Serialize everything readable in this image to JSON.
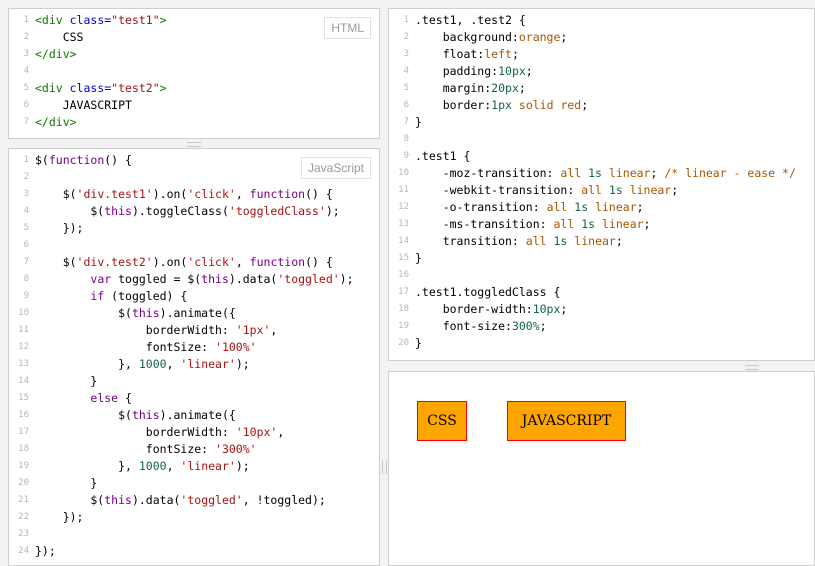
{
  "html_panel": {
    "badge": "HTML",
    "lines": [
      {
        "n": "1",
        "seg": [
          {
            "t": "<div ",
            "c": "t"
          },
          {
            "t": "class=",
            "c": "a"
          },
          {
            "t": "\"test1\"",
            "c": "s"
          },
          {
            "t": ">",
            "c": "t"
          }
        ]
      },
      {
        "n": "2",
        "seg": [
          {
            "t": "    CSS",
            "c": "p"
          }
        ]
      },
      {
        "n": "3",
        "seg": [
          {
            "t": "</div>",
            "c": "t"
          }
        ]
      },
      {
        "n": "4",
        "seg": []
      },
      {
        "n": "5",
        "seg": [
          {
            "t": "<div ",
            "c": "t"
          },
          {
            "t": "class=",
            "c": "a"
          },
          {
            "t": "\"test2\"",
            "c": "s"
          },
          {
            "t": ">",
            "c": "t"
          }
        ]
      },
      {
        "n": "6",
        "seg": [
          {
            "t": "    JAVASCRIPT",
            "c": "p"
          }
        ]
      },
      {
        "n": "7",
        "seg": [
          {
            "t": "</div>",
            "c": "t"
          }
        ]
      }
    ]
  },
  "js_panel": {
    "badge": "JavaScript",
    "lines": [
      {
        "n": "1",
        "seg": [
          {
            "t": "$(",
            "c": "p"
          },
          {
            "t": "function",
            "c": "k"
          },
          {
            "t": "() {",
            "c": "p"
          }
        ]
      },
      {
        "n": "2",
        "seg": []
      },
      {
        "n": "3",
        "seg": [
          {
            "t": "    $(",
            "c": "p"
          },
          {
            "t": "'div.test1'",
            "c": "s"
          },
          {
            "t": ").on(",
            "c": "p"
          },
          {
            "t": "'click'",
            "c": "s"
          },
          {
            "t": ", ",
            "c": "p"
          },
          {
            "t": "function",
            "c": "k"
          },
          {
            "t": "() {",
            "c": "p"
          }
        ]
      },
      {
        "n": "4",
        "seg": [
          {
            "t": "        $(",
            "c": "p"
          },
          {
            "t": "this",
            "c": "k"
          },
          {
            "t": ").toggleClass(",
            "c": "p"
          },
          {
            "t": "'toggledClass'",
            "c": "s"
          },
          {
            "t": ");",
            "c": "p"
          }
        ]
      },
      {
        "n": "5",
        "seg": [
          {
            "t": "    });",
            "c": "p"
          }
        ]
      },
      {
        "n": "6",
        "seg": []
      },
      {
        "n": "7",
        "seg": [
          {
            "t": "    $(",
            "c": "p"
          },
          {
            "t": "'div.test2'",
            "c": "s"
          },
          {
            "t": ").on(",
            "c": "p"
          },
          {
            "t": "'click'",
            "c": "s"
          },
          {
            "t": ", ",
            "c": "p"
          },
          {
            "t": "function",
            "c": "k"
          },
          {
            "t": "() {",
            "c": "p"
          }
        ]
      },
      {
        "n": "8",
        "seg": [
          {
            "t": "        ",
            "c": "p"
          },
          {
            "t": "var",
            "c": "k"
          },
          {
            "t": " toggled = $(",
            "c": "p"
          },
          {
            "t": "this",
            "c": "k"
          },
          {
            "t": ").data(",
            "c": "p"
          },
          {
            "t": "'toggled'",
            "c": "s"
          },
          {
            "t": ");",
            "c": "p"
          }
        ]
      },
      {
        "n": "9",
        "seg": [
          {
            "t": "        ",
            "c": "p"
          },
          {
            "t": "if",
            "c": "k"
          },
          {
            "t": " (toggled) {",
            "c": "p"
          }
        ]
      },
      {
        "n": "10",
        "seg": [
          {
            "t": "            $(",
            "c": "p"
          },
          {
            "t": "this",
            "c": "k"
          },
          {
            "t": ").animate({",
            "c": "p"
          }
        ]
      },
      {
        "n": "11",
        "seg": [
          {
            "t": "                borderWidth: ",
            "c": "p"
          },
          {
            "t": "'1px'",
            "c": "s"
          },
          {
            "t": ",",
            "c": "p"
          }
        ]
      },
      {
        "n": "12",
        "seg": [
          {
            "t": "                fontSize: ",
            "c": "p"
          },
          {
            "t": "'100%'",
            "c": "s"
          }
        ]
      },
      {
        "n": "13",
        "seg": [
          {
            "t": "            }, ",
            "c": "p"
          },
          {
            "t": "1000",
            "c": "n"
          },
          {
            "t": ", ",
            "c": "p"
          },
          {
            "t": "'linear'",
            "c": "s"
          },
          {
            "t": ");",
            "c": "p"
          }
        ]
      },
      {
        "n": "14",
        "seg": [
          {
            "t": "        }",
            "c": "p"
          }
        ]
      },
      {
        "n": "15",
        "seg": [
          {
            "t": "        ",
            "c": "p"
          },
          {
            "t": "else",
            "c": "k"
          },
          {
            "t": " {",
            "c": "p"
          }
        ]
      },
      {
        "n": "16",
        "seg": [
          {
            "t": "            $(",
            "c": "p"
          },
          {
            "t": "this",
            "c": "k"
          },
          {
            "t": ").animate({",
            "c": "p"
          }
        ]
      },
      {
        "n": "17",
        "seg": [
          {
            "t": "                borderWidth: ",
            "c": "p"
          },
          {
            "t": "'10px'",
            "c": "s"
          },
          {
            "t": ",",
            "c": "p"
          }
        ]
      },
      {
        "n": "18",
        "seg": [
          {
            "t": "                fontSize: ",
            "c": "p"
          },
          {
            "t": "'300%'",
            "c": "s"
          }
        ]
      },
      {
        "n": "19",
        "seg": [
          {
            "t": "            }, ",
            "c": "p"
          },
          {
            "t": "1000",
            "c": "n"
          },
          {
            "t": ", ",
            "c": "p"
          },
          {
            "t": "'linear'",
            "c": "s"
          },
          {
            "t": ");",
            "c": "p"
          }
        ]
      },
      {
        "n": "20",
        "seg": [
          {
            "t": "        }",
            "c": "p"
          }
        ]
      },
      {
        "n": "21",
        "seg": [
          {
            "t": "        $(",
            "c": "p"
          },
          {
            "t": "this",
            "c": "k"
          },
          {
            "t": ").data(",
            "c": "p"
          },
          {
            "t": "'toggled'",
            "c": "s"
          },
          {
            "t": ", !toggled);",
            "c": "p"
          }
        ]
      },
      {
        "n": "22",
        "seg": [
          {
            "t": "    });",
            "c": "p"
          }
        ]
      },
      {
        "n": "23",
        "seg": []
      },
      {
        "n": "24",
        "seg": [
          {
            "t": "});",
            "c": "p"
          }
        ]
      }
    ]
  },
  "css_panel": {
    "lines": [
      {
        "n": "1",
        "seg": [
          {
            "t": ".test1, .test2 {",
            "c": "p"
          }
        ]
      },
      {
        "n": "2",
        "seg": [
          {
            "t": "    background:",
            "c": "p"
          },
          {
            "t": "orange",
            "c": "v"
          },
          {
            "t": ";",
            "c": "p"
          }
        ]
      },
      {
        "n": "3",
        "seg": [
          {
            "t": "    float:",
            "c": "p"
          },
          {
            "t": "left",
            "c": "v"
          },
          {
            "t": ";",
            "c": "p"
          }
        ]
      },
      {
        "n": "4",
        "seg": [
          {
            "t": "    padding:",
            "c": "p"
          },
          {
            "t": "10px",
            "c": "n"
          },
          {
            "t": ";",
            "c": "p"
          }
        ]
      },
      {
        "n": "5",
        "seg": [
          {
            "t": "    margin:",
            "c": "p"
          },
          {
            "t": "20px",
            "c": "n"
          },
          {
            "t": ";",
            "c": "p"
          }
        ]
      },
      {
        "n": "6",
        "seg": [
          {
            "t": "    border:",
            "c": "p"
          },
          {
            "t": "1px",
            "c": "n"
          },
          {
            "t": " ",
            "c": "p"
          },
          {
            "t": "solid",
            "c": "v"
          },
          {
            "t": " ",
            "c": "p"
          },
          {
            "t": "red",
            "c": "v"
          },
          {
            "t": ";",
            "c": "p"
          }
        ]
      },
      {
        "n": "7",
        "seg": [
          {
            "t": "}",
            "c": "p"
          }
        ]
      },
      {
        "n": "8",
        "seg": []
      },
      {
        "n": "9",
        "seg": [
          {
            "t": ".test1 {",
            "c": "p"
          }
        ]
      },
      {
        "n": "10",
        "seg": [
          {
            "t": "    -moz-transition: ",
            "c": "p"
          },
          {
            "t": "all",
            "c": "v"
          },
          {
            "t": " ",
            "c": "p"
          },
          {
            "t": "1s",
            "c": "n"
          },
          {
            "t": " ",
            "c": "p"
          },
          {
            "t": "linear",
            "c": "v"
          },
          {
            "t": "; ",
            "c": "p"
          },
          {
            "t": "/* linear - ease */",
            "c": "c"
          }
        ]
      },
      {
        "n": "11",
        "seg": [
          {
            "t": "    -webkit-transition: ",
            "c": "p"
          },
          {
            "t": "all",
            "c": "v"
          },
          {
            "t": " ",
            "c": "p"
          },
          {
            "t": "1s",
            "c": "n"
          },
          {
            "t": " ",
            "c": "p"
          },
          {
            "t": "linear",
            "c": "v"
          },
          {
            "t": ";",
            "c": "p"
          }
        ]
      },
      {
        "n": "12",
        "seg": [
          {
            "t": "    -o-transition: ",
            "c": "p"
          },
          {
            "t": "all",
            "c": "v"
          },
          {
            "t": " ",
            "c": "p"
          },
          {
            "t": "1s",
            "c": "n"
          },
          {
            "t": " ",
            "c": "p"
          },
          {
            "t": "linear",
            "c": "v"
          },
          {
            "t": ";",
            "c": "p"
          }
        ]
      },
      {
        "n": "13",
        "seg": [
          {
            "t": "    -ms-transition: ",
            "c": "p"
          },
          {
            "t": "all",
            "c": "v"
          },
          {
            "t": " ",
            "c": "p"
          },
          {
            "t": "1s",
            "c": "n"
          },
          {
            "t": " ",
            "c": "p"
          },
          {
            "t": "linear",
            "c": "v"
          },
          {
            "t": ";",
            "c": "p"
          }
        ]
      },
      {
        "n": "14",
        "seg": [
          {
            "t": "    transition: ",
            "c": "p"
          },
          {
            "t": "all",
            "c": "v"
          },
          {
            "t": " ",
            "c": "p"
          },
          {
            "t": "1s",
            "c": "n"
          },
          {
            "t": " ",
            "c": "p"
          },
          {
            "t": "linear",
            "c": "v"
          },
          {
            "t": ";",
            "c": "p"
          }
        ]
      },
      {
        "n": "15",
        "seg": [
          {
            "t": "}",
            "c": "p"
          }
        ]
      },
      {
        "n": "16",
        "seg": []
      },
      {
        "n": "17",
        "seg": [
          {
            "t": ".test1.toggledClass {",
            "c": "p"
          }
        ]
      },
      {
        "n": "18",
        "seg": [
          {
            "t": "    border-width:",
            "c": "p"
          },
          {
            "t": "10px",
            "c": "n"
          },
          {
            "t": ";",
            "c": "p"
          }
        ]
      },
      {
        "n": "19",
        "seg": [
          {
            "t": "    font-size:",
            "c": "p"
          },
          {
            "t": "300%",
            "c": "n"
          },
          {
            "t": ";",
            "c": "p"
          }
        ]
      },
      {
        "n": "20",
        "seg": [
          {
            "t": "}",
            "c": "p"
          }
        ]
      }
    ]
  },
  "result_panel": {
    "box1_label": "CSS",
    "box2_label": "JAVASCRIPT",
    "box_bg": "#ffa500",
    "box_border": "#ff0000"
  }
}
